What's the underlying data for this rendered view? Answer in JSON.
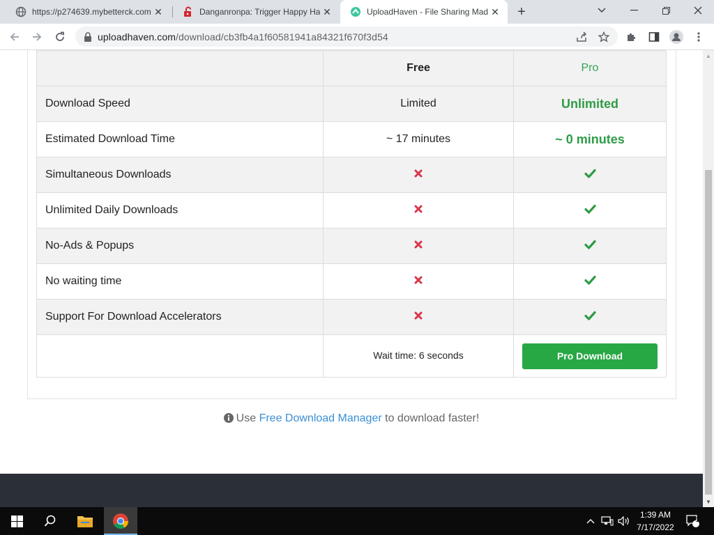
{
  "browser": {
    "tabs": [
      {
        "title": "https://p274639.mybetterck.com",
        "icon": "globe-icon"
      },
      {
        "title": "Danganronpa: Trigger Happy Ha",
        "icon": "red-lock-icon"
      },
      {
        "title": "UploadHaven - File Sharing Mad",
        "icon": "uploadhaven-icon"
      }
    ],
    "url_host": "uploadhaven.com",
    "url_path": "/download/cb3fb4a1f60581941a84321f670f3d54"
  },
  "comparison": {
    "header": {
      "free": "Free",
      "pro": "Pro"
    },
    "rows": [
      {
        "feature": "Download Speed",
        "free": "Limited",
        "pro": "Unlimited"
      },
      {
        "feature": "Estimated Download Time",
        "free": "~ 17 minutes",
        "pro": "~ 0 minutes"
      },
      {
        "feature": "Simultaneous Downloads",
        "free": "no",
        "pro": "yes"
      },
      {
        "feature": "Unlimited Daily Downloads",
        "free": "no",
        "pro": "yes"
      },
      {
        "feature": "No-Ads & Popups",
        "free": "no",
        "pro": "yes"
      },
      {
        "feature": "No waiting time",
        "free": "no",
        "pro": "yes"
      },
      {
        "feature": "Support For Download Accelerators",
        "free": "no",
        "pro": "yes"
      }
    ],
    "wait_time": "Wait time: 6 seconds",
    "pro_download_label": "Pro Download"
  },
  "fdm_notice": {
    "prefix": "Use",
    "link": "Free Download Manager",
    "suffix": "to download faster!"
  },
  "taskbar": {
    "time": "1:39 AM",
    "date": "7/17/2022",
    "notification_count": "1"
  },
  "colors": {
    "pro_green": "#2e9b45",
    "button_green": "#28a745",
    "cross_red": "#d9354b",
    "link_blue": "#3a8fd6",
    "footer_dark": "#2b3038"
  }
}
